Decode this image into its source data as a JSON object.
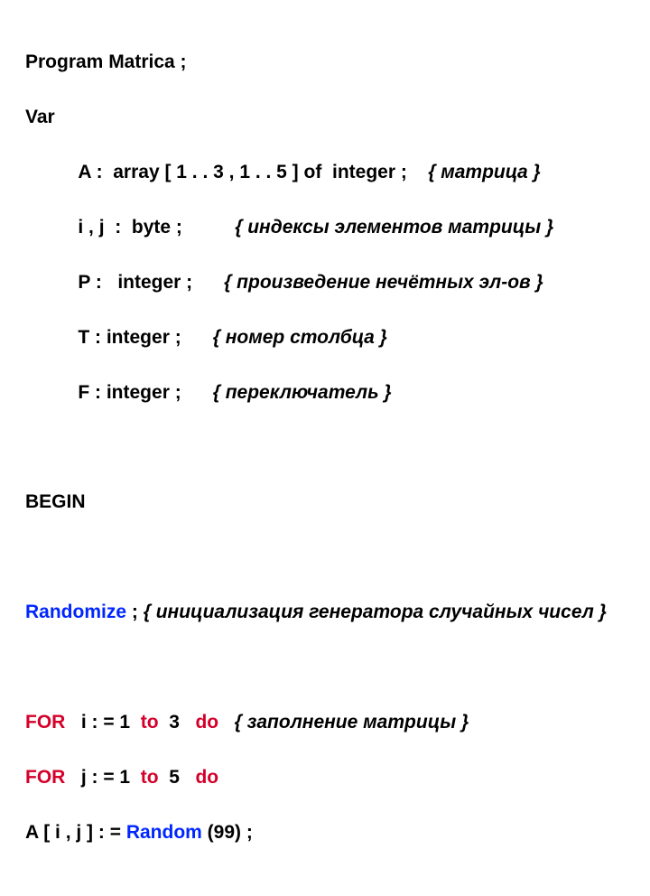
{
  "line1": {
    "program": "Program Matrica ;"
  },
  "line2": {
    "var": "Var"
  },
  "decl": {
    "a": {
      "indent": "          ",
      "code": "A :  array [ 1 . . 3 , 1 . . 5 ] of  integer ;    ",
      "comment": "{ матрица }"
    },
    "ij": {
      "indent": "          ",
      "code": "i , j  :  byte ;          ",
      "comment": "{ индексы элементов матрицы }"
    },
    "p": {
      "indent": "          ",
      "code": "P :   integer ;      ",
      "comment": "{ произведение нечётных эл-ов }"
    },
    "t": {
      "indent": "          ",
      "code": "T : integer ;      ",
      "comment": "{ номер столбца }"
    },
    "f": {
      "indent": "          ",
      "code": "F : integer ;      ",
      "comment": "{ переключатель }"
    }
  },
  "begin": "BEGIN",
  "rand": {
    "kw": "Randomize",
    "tail": " ; ",
    "comment": "{ инициализация генератора случайных чисел }"
  },
  "for1": {
    "kw_for": "FOR",
    "mid1": "   i : = 1  ",
    "kw_to": "to",
    "mid2": "  3   ",
    "kw_do": "do",
    "tail": "   ",
    "comment": "{ заполнение матрицы }"
  },
  "for2": {
    "kw_for": "FOR",
    "mid1": "   j : = 1  ",
    "kw_to": "to",
    "mid2": "  5   ",
    "kw_do": "do"
  },
  "assign": {
    "lhs": "A [ i , j ] : = ",
    "fn": "Random",
    "rhs": " (99) ;"
  }
}
